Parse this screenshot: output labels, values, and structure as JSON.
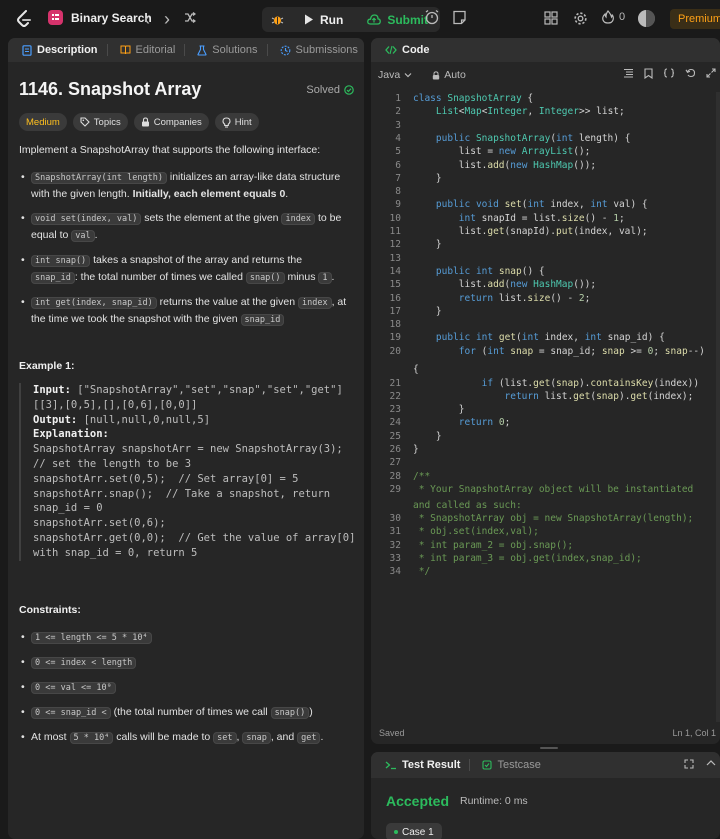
{
  "topbar": {
    "title": "Binary Search",
    "nav_prev": "‹",
    "nav_next": "›",
    "run_label": "Run",
    "submit_label": "Submit",
    "streak_count": "0",
    "premium_label": "Premium"
  },
  "left_tabs": [
    {
      "label": "Description"
    },
    {
      "label": "Editorial"
    },
    {
      "label": "Solutions"
    },
    {
      "label": "Submissions"
    }
  ],
  "problem": {
    "title": "1146. Snapshot Array",
    "status": "Solved",
    "difficulty": "Medium",
    "chips": [
      "Topics",
      "Companies",
      "Hint"
    ],
    "intro": "Implement a SnapshotArray that supports the following interface:",
    "bullets": [
      {
        "code": "SnapshotArray(int length)",
        "text": " initializes an array-like data structure with the given length. ",
        "bold": "Initially, each element equals 0",
        "tail": "."
      },
      {
        "code": "void set(index, val)",
        "text": " sets the element at the given ",
        "code2": "index",
        "text2": " to be equal to ",
        "code3": "val",
        "tail": "."
      },
      {
        "code": "int snap()",
        "text": " takes a snapshot of the array and returns the ",
        "code2": "snap_id",
        "text2": ": the total number of times we called ",
        "code3": "snap()",
        "text3": " minus ",
        "code4": "1",
        "tail": "."
      },
      {
        "code": "int get(index, snap_id)",
        "text": " returns the value at the given ",
        "code2": "index",
        "text2": ", at the time we took the snapshot with the given ",
        "code3": "snap_id",
        "tail": ""
      }
    ],
    "example_title": "Example 1:",
    "example_input_label": "Input:",
    "example_input": " [\"SnapshotArray\",\"set\",\"snap\",\"set\",\"get\"]\n[[3],[0,5],[],[0,6],[0,0]]",
    "example_output_label": "Output:",
    "example_output": " [null,null,0,null,5]",
    "example_expl_label": "Explanation:",
    "example_expl": "SnapshotArray snapshotArr = new SnapshotArray(3);\n// set the length to be 3\nsnapshotArr.set(0,5);  // Set array[0] = 5\nsnapshotArr.snap();  // Take a snapshot, return\nsnap_id = 0\nsnapshotArr.set(0,6);\nsnapshotArr.get(0,0);  // Get the value of array[0]\nwith snap_id = 0, return 5",
    "constraints_title": "Constraints:",
    "constraints": [
      {
        "code": "1 <= length <= 5 * 10⁴",
        "text": ""
      },
      {
        "code": "0 <= index < length",
        "text": ""
      },
      {
        "code": "0 <= val <= 10⁹",
        "text": ""
      },
      {
        "code": "0 <= snap_id <",
        "text": " (the total number of times we call ",
        "code2": "snap()",
        "tail": ")"
      },
      {
        "pre": "At most ",
        "code": "5 * 10⁴",
        "text": " calls will be made to ",
        "code2": "set",
        "text2": ", ",
        "code3": "snap",
        "text3": ", and ",
        "code4": "get",
        "tail": "."
      }
    ]
  },
  "code_panel": {
    "tab_label": "Code",
    "language": "Java",
    "mode": "Auto",
    "status": "Saved",
    "cursor": "Ln 1, Col 1",
    "lines": [
      {
        "n": "1",
        "src": "class SnapshotArray {"
      },
      {
        "n": "2",
        "src": "    List<Map<Integer, Integer>> list;"
      },
      {
        "n": "3",
        "src": ""
      },
      {
        "n": "4",
        "src": "    public SnapshotArray(int length) {"
      },
      {
        "n": "5",
        "src": "        list = new ArrayList();"
      },
      {
        "n": "6",
        "src": "        list.add(new HashMap());"
      },
      {
        "n": "7",
        "src": "    }"
      },
      {
        "n": "8",
        "src": ""
      },
      {
        "n": "9",
        "src": "    public void set(int index, int val) {"
      },
      {
        "n": "10",
        "src": "        int snapId = list.size() - 1;"
      },
      {
        "n": "11",
        "src": "        list.get(snapId).put(index, val);"
      },
      {
        "n": "12",
        "src": "    }"
      },
      {
        "n": "13",
        "src": ""
      },
      {
        "n": "14",
        "src": "    public int snap() {"
      },
      {
        "n": "15",
        "src": "        list.add(new HashMap());"
      },
      {
        "n": "16",
        "src": "        return list.size() - 2;"
      },
      {
        "n": "17",
        "src": "    }"
      },
      {
        "n": "18",
        "src": ""
      },
      {
        "n": "19",
        "src": "    public int get(int index, int snap_id) {"
      },
      {
        "n": "20",
        "src": "        for (int snap = snap_id; snap >= 0; snap--)"
      },
      {
        "n": "",
        "src": "{"
      },
      {
        "n": "21",
        "src": "            if (list.get(snap).containsKey(index))"
      },
      {
        "n": "22",
        "src": "                return list.get(snap).get(index);"
      },
      {
        "n": "23",
        "src": "        }"
      },
      {
        "n": "24",
        "src": "        return 0;"
      },
      {
        "n": "25",
        "src": "    }"
      },
      {
        "n": "26",
        "src": "}"
      },
      {
        "n": "27",
        "src": ""
      },
      {
        "n": "28",
        "src": "/**"
      },
      {
        "n": "29",
        "src": " * Your SnapshotArray object will be instantiated"
      },
      {
        "n": "",
        "src": "and called as such:"
      },
      {
        "n": "30",
        "src": " * SnapshotArray obj = new SnapshotArray(length);"
      },
      {
        "n": "31",
        "src": " * obj.set(index,val);"
      },
      {
        "n": "32",
        "src": " * int param_2 = obj.snap();"
      },
      {
        "n": "33",
        "src": " * int param_3 = obj.get(index,snap_id);"
      },
      {
        "n": "34",
        "src": " */"
      }
    ]
  },
  "result_panel": {
    "tab1": "Test Result",
    "tab2": "Testcase",
    "verdict": "Accepted",
    "runtime": "Runtime: 0 ms",
    "case_label": "Case 1"
  },
  "colors": {
    "accent_green": "#2cbb5d",
    "medium_yellow": "#ffc01e",
    "premium_orange": "#ffa116"
  }
}
